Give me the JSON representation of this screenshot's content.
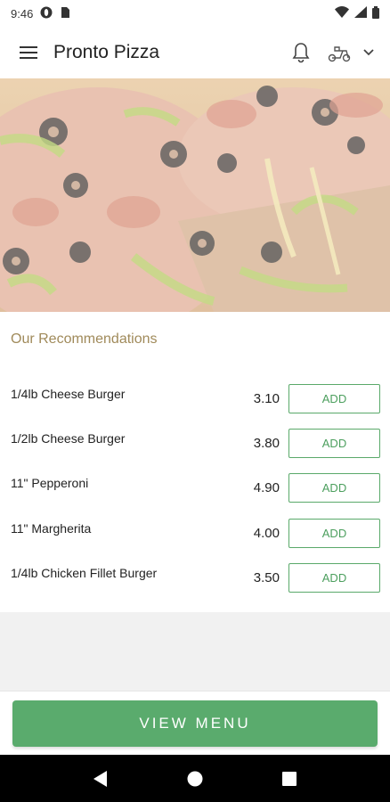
{
  "status_bar": {
    "time": "9:46",
    "left_icons": [
      "opera-icon",
      "sim-card-icon"
    ],
    "right_icons": [
      "wifi-icon",
      "signal-icon",
      "battery-icon"
    ]
  },
  "app_bar": {
    "title": "Pronto Pizza",
    "icons": [
      "hamburger-menu-icon",
      "bell-icon",
      "delivery-scooter-icon",
      "chevron-down-icon"
    ]
  },
  "hero": {
    "image": "pizza-photo"
  },
  "recommendations": {
    "title": "Our Recommendations",
    "add_label": "ADD",
    "items": [
      {
        "name": "1/4lb Cheese Burger",
        "price": "3.10"
      },
      {
        "name": "1/2lb Cheese Burger",
        "price": "3.80"
      },
      {
        "name": "11\" Pepperoni",
        "price": "4.90"
      },
      {
        "name": "11\" Margherita",
        "price": "4.00"
      },
      {
        "name": "1/4lb Chicken Fillet Burger",
        "price": "3.50"
      }
    ]
  },
  "footer": {
    "button_label": "VIEW MENU"
  },
  "nav_bar": {
    "icons": [
      "back-icon",
      "home-icon",
      "recents-icon"
    ]
  },
  "colors": {
    "accent_green": "#5aab6d",
    "section_title": "#a08a5a"
  }
}
